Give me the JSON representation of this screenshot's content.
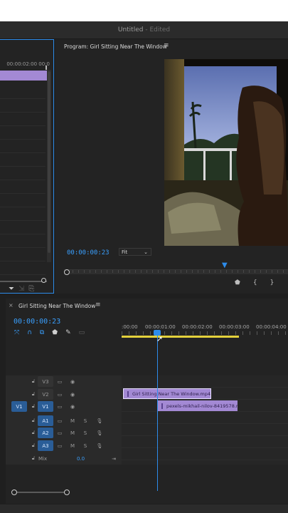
{
  "window": {
    "title": "Untitled",
    "status": "- Edited"
  },
  "source_panel": {
    "ruler_label": "00:00:02:00  00:0"
  },
  "program_monitor": {
    "title": "Program: Girl Sitting Near The Window",
    "menu_icon": "hamburger-icon",
    "timecode": "00:00:00:23",
    "zoom": "Fit",
    "controls": [
      "marker-icon",
      "mark-in-icon",
      "mark-out-icon"
    ]
  },
  "timeline": {
    "sequence_title": "Girl Sitting Near The Window",
    "timecode": "00:00:00:23",
    "ruler_labels": [
      ":00:00",
      "00:00:01:00",
      "00:00:02:00",
      "00:00:03:00",
      "00:00:04:00"
    ],
    "tools": [
      "ripple-icon",
      "snap-icon",
      "linked-icon",
      "marker-icon",
      "wrench-icon",
      "captions-icon"
    ],
    "tracks": [
      {
        "name": "V3",
        "type": "video"
      },
      {
        "name": "V2",
        "type": "video"
      },
      {
        "name": "V1",
        "type": "video",
        "source": "V1"
      },
      {
        "name": "A1",
        "type": "audio",
        "m": "M",
        "s": "S"
      },
      {
        "name": "A2",
        "type": "audio",
        "m": "M",
        "s": "S"
      },
      {
        "name": "A3",
        "type": "audio",
        "m": "M",
        "s": "S"
      }
    ],
    "mix": {
      "label": "Mix",
      "value": "0.0"
    },
    "clips": [
      {
        "track": "V2",
        "name": "Girl Sitting Near The Window.mp4"
      },
      {
        "track": "V1",
        "name": "pexels-mikhail-nilov-8419578.m"
      }
    ]
  },
  "colors": {
    "accent": "#2d8ceb",
    "clip": "#a389d4",
    "work_area": "#e3d13c"
  }
}
